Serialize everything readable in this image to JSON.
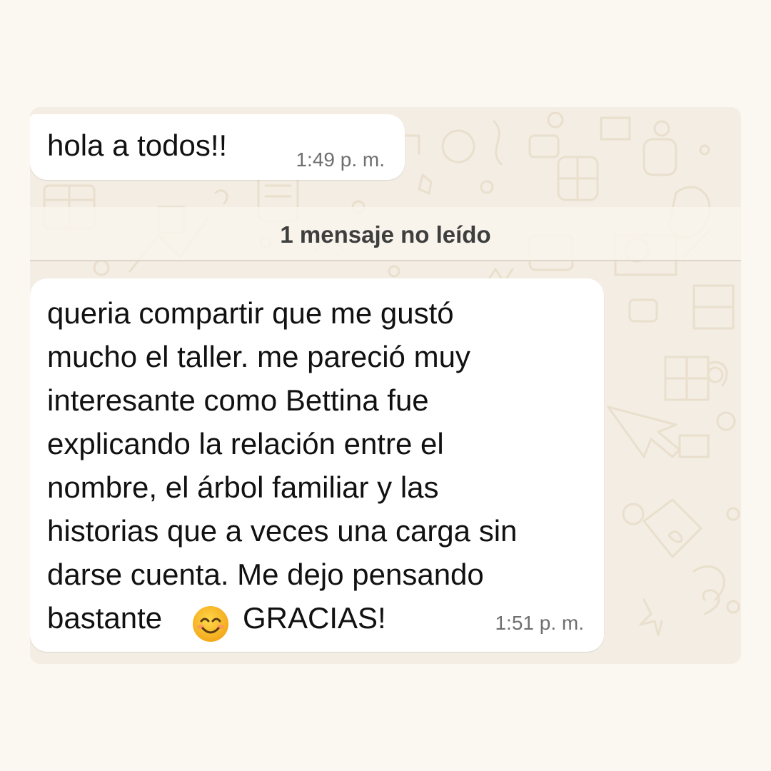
{
  "conversation": {
    "messages": [
      {
        "text": "hola a todos!!",
        "time": "1:49 p. m."
      },
      {
        "text": "queria compartir que me gustó\nmucho el taller. me pareció muy\ninteresante como Bettina fue\nexplicando la relación entre el\nnombre, el árbol familiar y las\nhistorias que a veces una carga sin\ndarse cuenta. Me dejo pensando\nbastante",
        "text_after_emoji": "GRACIAS!",
        "time": "1:51 p. m."
      }
    ],
    "unread_banner": "1 mensaje no leído"
  },
  "icons": {
    "emoji": "smiling-face-with-smiling-eyes-icon",
    "wallpaper": "whatsapp-doodle-wallpaper"
  },
  "colors": {
    "page_background": "#fbf8f2",
    "chat_background": "#f3ede3",
    "bubble_background": "#ffffff",
    "time_text": "#6f6f6f",
    "unread_text": "#3e3e3e"
  }
}
